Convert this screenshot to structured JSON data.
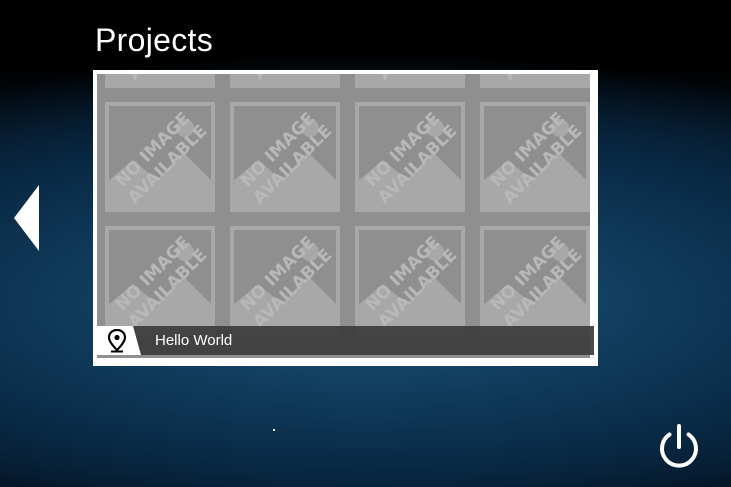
{
  "header": {
    "title": "Projects"
  },
  "navigation": {
    "prev_icon": "triangle-left-icon"
  },
  "project_card": {
    "name": "Hello World",
    "location_icon": "map-pin-icon",
    "placeholder_text_line1": "NO IMAGE",
    "placeholder_text_line2": "AVAILABLE"
  },
  "footer": {
    "power_icon": "power-icon"
  },
  "colors": {
    "placeholder_bg": "#8f8f8f",
    "placeholder_fg": "#a8a8a8",
    "caption_bg": "#3c3c3c",
    "text": "#ffffff"
  }
}
